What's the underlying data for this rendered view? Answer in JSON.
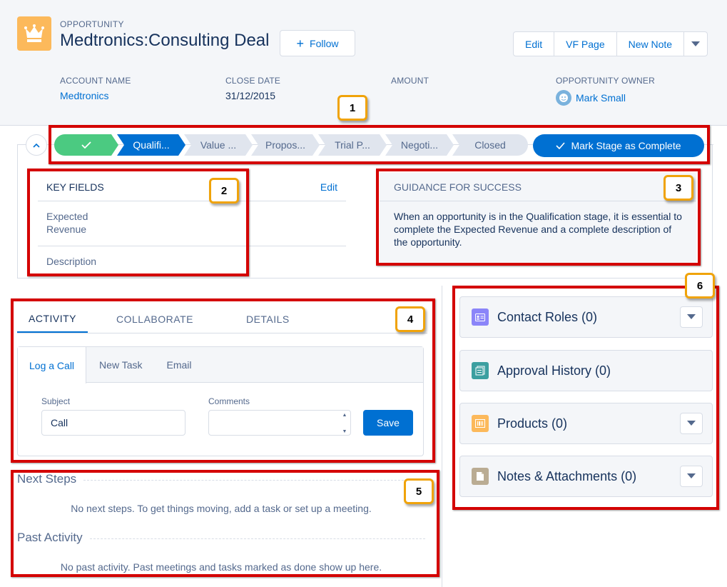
{
  "record": {
    "object_label": "OPPORTUNITY",
    "title": "Medtronics:Consulting Deal",
    "follow_label": "Follow",
    "actions": [
      "Edit",
      "VF Page",
      "New Note"
    ]
  },
  "highlights": [
    {
      "label": "ACCOUNT NAME",
      "value": "Medtronics"
    },
    {
      "label": "CLOSE DATE",
      "value": "31/12/2015"
    },
    {
      "label": "AMOUNT",
      "value": ""
    },
    {
      "label": "OPPORTUNITY OWNER",
      "value": "Mark Small"
    }
  ],
  "path": {
    "stages": [
      "Qualifi...",
      "Value ...",
      "Propos...",
      "Trial P...",
      "Negoti...",
      "Closed"
    ],
    "mark_complete_label": "Mark Stage as Complete"
  },
  "key_fields": {
    "title": "KEY FIELDS",
    "edit_label": "Edit",
    "fields": [
      "Expected Revenue",
      "Description"
    ]
  },
  "guidance": {
    "title": "GUIDANCE FOR SUCCESS",
    "text": "When an opportunity is in the Qualification stage, it is essential to complete the Expected Revenue and a complete description of the opportunity."
  },
  "tabs": [
    "ACTIVITY",
    "COLLABORATE",
    "DETAILS"
  ],
  "activity": {
    "subtabs": [
      "Log a Call",
      "New Task",
      "Email"
    ],
    "subject_label": "Subject",
    "subject_value": "Call",
    "comments_label": "Comments",
    "save_label": "Save"
  },
  "timeline": {
    "next_steps_title": "Next Steps",
    "next_steps_empty": "No next steps. To get things moving, add a task or set up a meeting.",
    "past_title": "Past Activity",
    "past_empty": "No past activity. Past meetings and tasks marked as done show up here."
  },
  "related": [
    {
      "title": "Contact Roles (0)",
      "icon": "contact-card-icon",
      "color": "#8b85f9"
    },
    {
      "title": "Approval History (0)",
      "icon": "approval-icon",
      "color": "#3c9fa0"
    },
    {
      "title": "Products (0)",
      "icon": "barcode-icon",
      "color": "#fcb95b"
    },
    {
      "title": "Notes & Attachments (0)",
      "icon": "document-icon",
      "color": "#baac93"
    }
  ],
  "callouts": [
    "1",
    "2",
    "3",
    "4",
    "5",
    "6"
  ],
  "colors": {
    "brand": "#0070d2",
    "complete": "#4bca81",
    "callout_border": "#f0a30a",
    "highlight_box": "#d40000"
  }
}
